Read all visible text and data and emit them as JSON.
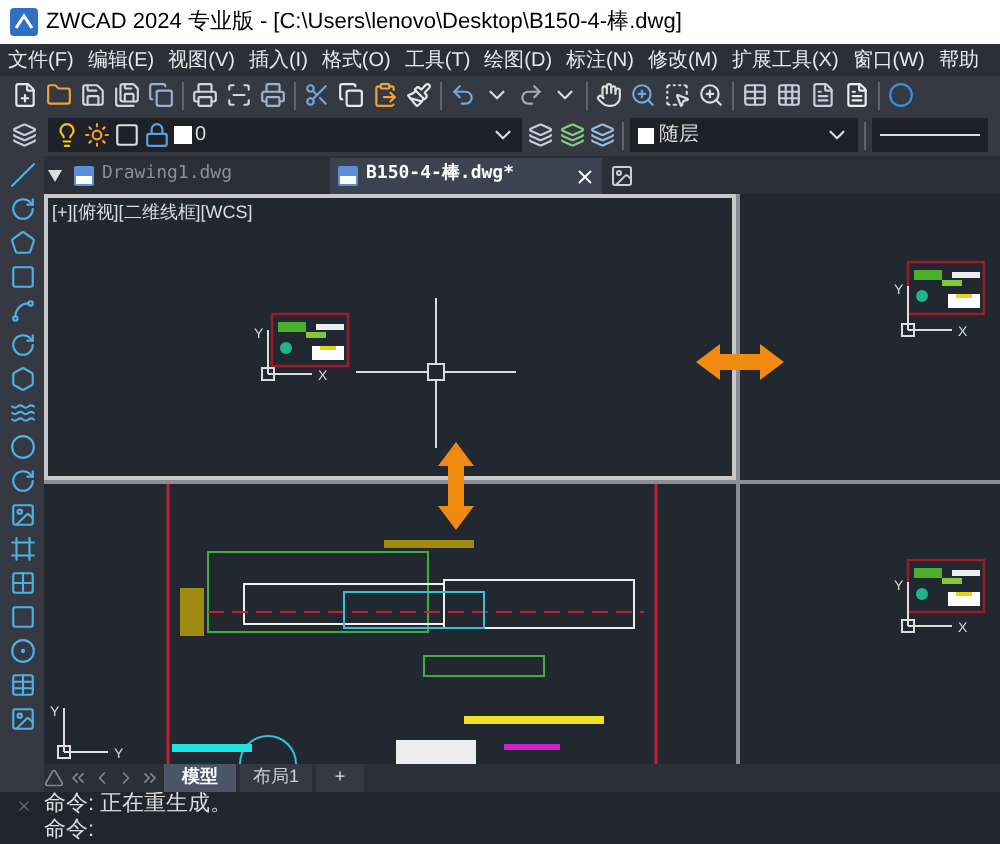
{
  "window": {
    "title": "ZWCAD 2024 专业版 - [C:\\Users\\lenovo\\Desktop\\B150-4-棒.dwg]"
  },
  "menu": [
    "文件(F)",
    "编辑(E)",
    "视图(V)",
    "插入(I)",
    "格式(O)",
    "工具(T)",
    "绘图(D)",
    "标注(N)",
    "修改(M)",
    "扩展工具(X)",
    "窗口(W)",
    "帮助"
  ],
  "layer": {
    "name": "0"
  },
  "color_control": {
    "value": "随层"
  },
  "doc_tabs": [
    {
      "label": "Drawing1.dwg",
      "selected": false
    },
    {
      "label": "B150-4-棒.dwg*",
      "selected": true
    }
  ],
  "viewport": {
    "label": "[+][俯视][二维线框][WCS]"
  },
  "ucs_icons": [
    {
      "x": "X",
      "y": "Y"
    },
    {
      "x": "X",
      "y": "Y"
    },
    {
      "x": "Y",
      "y": "Y"
    },
    {
      "x": "X",
      "y": "Y"
    }
  ],
  "layout_tabs": [
    {
      "label": "模型",
      "selected": true
    },
    {
      "label": "布局1",
      "selected": false
    }
  ],
  "new_layout": "+",
  "command_lines": [
    "命令: 正在重生成。",
    "命令:"
  ]
}
